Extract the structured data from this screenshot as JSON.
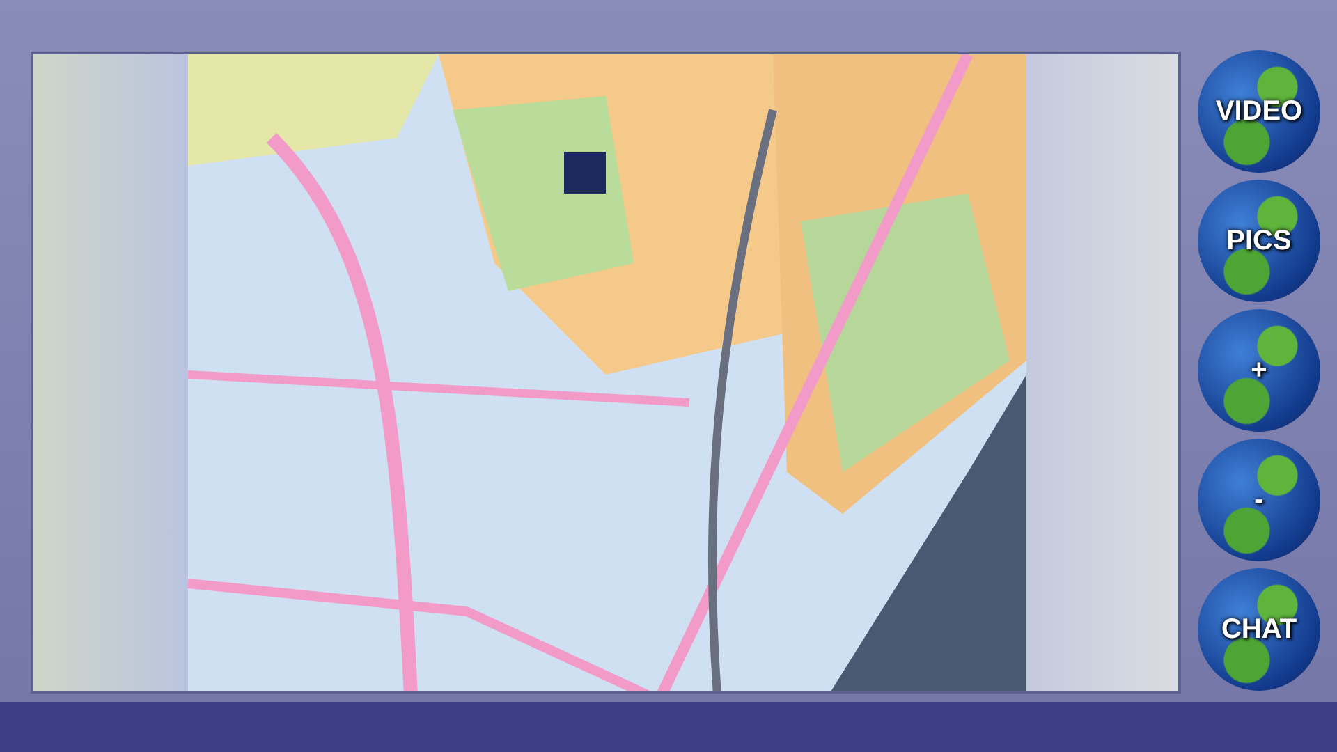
{
  "buttons": [
    {
      "label": "VIDEO"
    },
    {
      "label": "PICS"
    },
    {
      "label": "+"
    },
    {
      "label": "-"
    },
    {
      "label": "CHAT"
    }
  ]
}
